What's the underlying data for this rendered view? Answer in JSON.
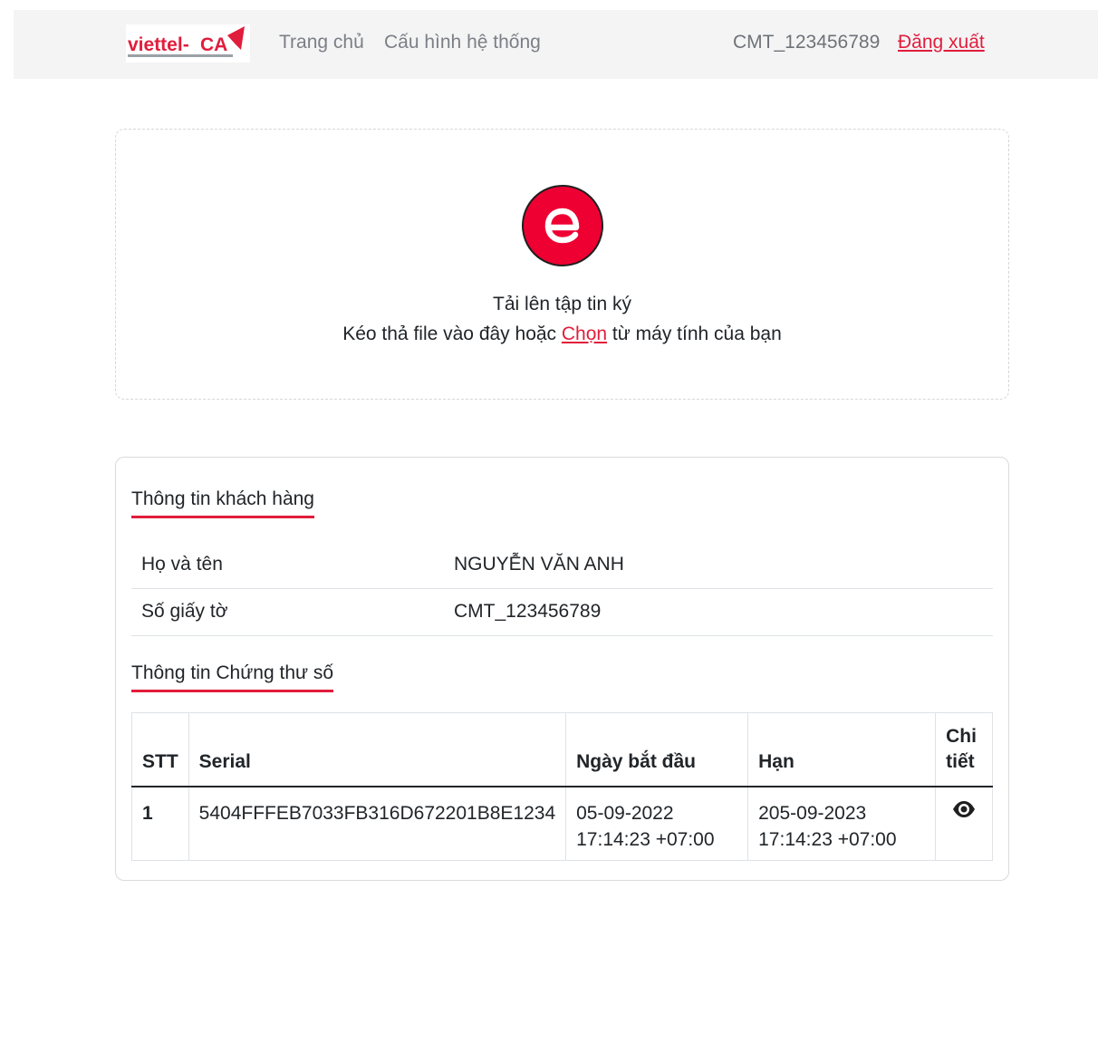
{
  "header": {
    "logo_text": "viettel-CA",
    "logo_tagline": "DỊCH VỤ CHỨNG THỰC CHỮ KÝ SỐ VIETTEL",
    "nav": [
      {
        "label": "Trang chủ"
      },
      {
        "label": "Cấu hình hệ thống"
      }
    ],
    "user_id": "CMT_123456789",
    "logout_label": "Đăng xuất"
  },
  "upload": {
    "icon": "e-sign-icon",
    "title": "Tải lên tập tin ký",
    "sub_before": "Kéo thả file vào đây hoặc ",
    "choose_label": "Chọn",
    "sub_after": " từ máy tính của bạn"
  },
  "customer": {
    "title": "Thông tin khách hàng",
    "rows": [
      {
        "label": "Họ và tên",
        "value": "NGUYỄN VĂN ANH"
      },
      {
        "label": "Số giấy tờ",
        "value": "CMT_123456789"
      }
    ]
  },
  "certificate": {
    "title": "Thông tin Chứng thư số",
    "columns": [
      "STT",
      "Serial",
      "Ngày bắt đầu",
      "Hạn",
      "Chi tiết"
    ],
    "rows": [
      {
        "stt": "1",
        "serial": "5404FFFEB7033FB316D672201B8E1234",
        "start_date": "05-09-2022",
        "start_time": "17:14:23 +07:00",
        "expiry_date": "205-09-2023",
        "expiry_time": "17:14:23 +07:00",
        "detail_icon": "eye-icon"
      }
    ]
  },
  "colors": {
    "accent": "#e11d3c",
    "brand_red": "#ee0033",
    "nav_bg": "#f4f4f5"
  }
}
